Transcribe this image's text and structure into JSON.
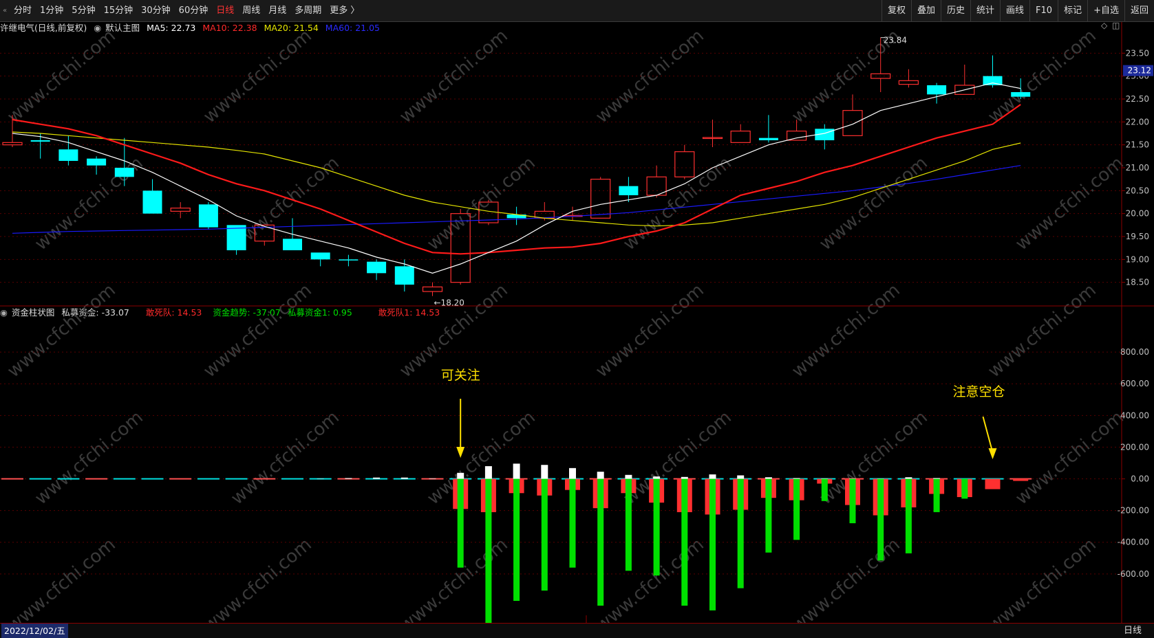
{
  "toolbar": {
    "left_items": [
      {
        "label": "分时",
        "active": false
      },
      {
        "label": "1分钟",
        "active": false
      },
      {
        "label": "5分钟",
        "active": false
      },
      {
        "label": "15分钟",
        "active": false
      },
      {
        "label": "30分钟",
        "active": false
      },
      {
        "label": "60分钟",
        "active": false
      },
      {
        "label": "日线",
        "active": true
      },
      {
        "label": "周线",
        "active": false
      },
      {
        "label": "月线",
        "active": false
      },
      {
        "label": "多周期",
        "active": false
      },
      {
        "label": "更多 〉",
        "active": false
      }
    ],
    "right_items": [
      "复权",
      "叠加",
      "历史",
      "统计",
      "画线",
      "F10",
      "标记",
      "+自选",
      "返回"
    ]
  },
  "main_indicator": {
    "stock": "许继电气(日线,前复权)",
    "template": "默认主图",
    "ma5": "MA5: 22.73",
    "ma10": "MA10: 22.38",
    "ma20": "MA20: 21.54",
    "ma60": "MA60: 21.05"
  },
  "sub_indicator": {
    "name": "资金柱状图",
    "v1": "私募资金: -33.07",
    "v2": "敢死队: 14.53",
    "v3": "资金趋势: -37.07",
    "v4": "私募资金1: 0.95",
    "v5": "敢死队1: 14.53"
  },
  "footer": {
    "date": "2022/12/02/五",
    "period": "日线"
  },
  "colors": {
    "up": "#ff3030",
    "down": "#00ffff",
    "ma5": "#ffffff",
    "ma10": "#ff1a1a",
    "ma20": "#e6e600",
    "ma60": "#1a1aff",
    "green_bar": "#00e000",
    "annotation": "#ffe000"
  },
  "chart_data": [
    {
      "type": "candlestick",
      "name": "许继电气 日线",
      "ylim": [
        18.0,
        24.0
      ],
      "yticks": [
        "18.50",
        "19.00",
        "19.50",
        "20.00",
        "20.50",
        "21.00",
        "21.50",
        "22.00",
        "22.50",
        "23.00",
        "23.50"
      ],
      "current_price": "23.12",
      "high_label": "23.84",
      "low_label": "←18.20",
      "candles": [
        {
          "o": 21.5,
          "c": 21.55,
          "h": 22.15,
          "l": 21.45
        },
        {
          "o": 21.6,
          "c": 21.57,
          "h": 21.75,
          "l": 21.2
        },
        {
          "o": 21.4,
          "c": 21.15,
          "h": 21.7,
          "l": 21.05
        },
        {
          "o": 21.2,
          "c": 21.05,
          "h": 21.25,
          "l": 20.85
        },
        {
          "o": 21.0,
          "c": 20.8,
          "h": 21.65,
          "l": 20.6
        },
        {
          "o": 20.5,
          "c": 20.0,
          "h": 20.75,
          "l": 20.0
        },
        {
          "o": 20.05,
          "c": 20.12,
          "h": 20.25,
          "l": 19.9
        },
        {
          "o": 20.2,
          "c": 19.7,
          "h": 20.25,
          "l": 19.65
        },
        {
          "o": 19.75,
          "c": 19.2,
          "h": 19.75,
          "l": 19.1
        },
        {
          "o": 19.4,
          "c": 19.75,
          "h": 19.75,
          "l": 19.3
        },
        {
          "o": 19.45,
          "c": 19.2,
          "h": 19.9,
          "l": 19.2
        },
        {
          "o": 19.15,
          "c": 19.0,
          "h": 19.15,
          "l": 18.85
        },
        {
          "o": 19.0,
          "c": 18.99,
          "h": 19.1,
          "l": 18.85
        },
        {
          "o": 18.95,
          "c": 18.7,
          "h": 19.0,
          "l": 18.55
        },
        {
          "o": 18.85,
          "c": 18.45,
          "h": 19.0,
          "l": 18.3
        },
        {
          "o": 18.3,
          "c": 18.4,
          "h": 18.5,
          "l": 18.2
        },
        {
          "o": 18.5,
          "c": 20.0,
          "h": 20.1,
          "l": 18.45
        },
        {
          "o": 19.8,
          "c": 20.25,
          "h": 20.3,
          "l": 19.75
        },
        {
          "o": 19.98,
          "c": 19.9,
          "h": 20.15,
          "l": 19.75
        },
        {
          "o": 19.9,
          "c": 20.05,
          "h": 20.25,
          "l": 19.85
        },
        {
          "o": 19.95,
          "c": 19.96,
          "h": 20.15,
          "l": 19.85
        },
        {
          "o": 19.9,
          "c": 20.75,
          "h": 20.8,
          "l": 19.9
        },
        {
          "o": 20.6,
          "c": 20.4,
          "h": 20.8,
          "l": 20.25
        },
        {
          "o": 20.4,
          "c": 20.8,
          "h": 21.05,
          "l": 20.35
        },
        {
          "o": 20.8,
          "c": 21.35,
          "h": 21.5,
          "l": 20.75
        },
        {
          "o": 21.65,
          "c": 21.66,
          "h": 22.05,
          "l": 21.45
        },
        {
          "o": 21.55,
          "c": 21.8,
          "h": 21.95,
          "l": 21.55
        },
        {
          "o": 21.65,
          "c": 21.6,
          "h": 22.15,
          "l": 21.55
        },
        {
          "o": 21.6,
          "c": 21.8,
          "h": 22.05,
          "l": 21.6
        },
        {
          "o": 21.85,
          "c": 21.6,
          "h": 21.95,
          "l": 21.4
        },
        {
          "o": 21.7,
          "c": 22.25,
          "h": 22.6,
          "l": 21.7
        },
        {
          "o": 22.95,
          "c": 23.05,
          "h": 23.84,
          "l": 22.65
        },
        {
          "o": 22.82,
          "c": 22.9,
          "h": 23.15,
          "l": 22.75
        },
        {
          "o": 22.8,
          "c": 22.6,
          "h": 22.85,
          "l": 22.4
        },
        {
          "o": 22.6,
          "c": 22.8,
          "h": 23.25,
          "l": 22.6
        },
        {
          "o": 23.0,
          "c": 22.8,
          "h": 23.45,
          "l": 22.75
        },
        {
          "o": 22.65,
          "c": 22.55,
          "h": 22.95,
          "l": 22.5
        }
      ],
      "ma5": [
        21.75,
        21.68,
        21.55,
        21.35,
        21.15,
        20.9,
        20.6,
        20.3,
        19.95,
        19.72,
        19.55,
        19.4,
        19.25,
        19.05,
        18.9,
        18.7,
        18.9,
        19.15,
        19.4,
        19.75,
        20.05,
        20.2,
        20.3,
        20.4,
        20.65,
        21.0,
        21.25,
        21.5,
        21.65,
        21.75,
        21.95,
        22.25,
        22.4,
        22.55,
        22.7,
        22.85,
        22.73
      ],
      "ma10": [
        22.05,
        21.95,
        21.85,
        21.7,
        21.5,
        21.3,
        21.1,
        20.85,
        20.65,
        20.5,
        20.3,
        20.1,
        19.85,
        19.6,
        19.35,
        19.15,
        19.12,
        19.15,
        19.2,
        19.25,
        19.27,
        19.35,
        19.5,
        19.62,
        19.8,
        20.1,
        20.4,
        20.55,
        20.7,
        20.9,
        21.05,
        21.25,
        21.45,
        21.65,
        21.8,
        21.95,
        22.38
      ],
      "ma20": [
        21.78,
        21.75,
        21.7,
        21.65,
        21.6,
        21.55,
        21.5,
        21.45,
        21.38,
        21.3,
        21.15,
        21.0,
        20.8,
        20.6,
        20.4,
        20.25,
        20.15,
        20.05,
        19.98,
        19.9,
        19.85,
        19.8,
        19.75,
        19.73,
        19.75,
        19.8,
        19.9,
        20.0,
        20.1,
        20.2,
        20.35,
        20.55,
        20.75,
        20.95,
        21.15,
        21.4,
        21.54
      ],
      "ma60": [
        19.57,
        19.59,
        19.61,
        19.62,
        19.63,
        19.64,
        19.65,
        19.66,
        19.68,
        19.7,
        19.72,
        19.74,
        19.76,
        19.78,
        19.8,
        19.82,
        19.84,
        19.86,
        19.88,
        19.91,
        19.94,
        19.98,
        20.02,
        20.08,
        20.14,
        20.2,
        20.26,
        20.32,
        20.38,
        20.44,
        20.5,
        20.58,
        20.66,
        20.75,
        20.85,
        20.95,
        21.05
      ]
    },
    {
      "type": "bar",
      "name": "资金柱状图",
      "ylim": [
        -900,
        1000
      ],
      "yticks": [
        "800.00",
        "600.00",
        "400.00",
        "200.00",
        "0.00",
        "-200.00",
        "-400.00",
        "-600.00"
      ],
      "white": [
        0,
        0,
        0,
        0,
        0,
        0,
        0,
        0,
        0,
        0,
        0,
        2,
        5,
        8,
        8,
        3,
        38,
        80,
        96,
        88,
        68,
        45,
        25,
        15,
        12,
        28,
        22,
        10,
        5,
        3,
        2,
        2,
        10,
        5,
        0,
        0,
        0
      ],
      "red": [
        0,
        0,
        0,
        0,
        0,
        0,
        0,
        0,
        0,
        0,
        0,
        0,
        0,
        0,
        0,
        0,
        -190,
        -210,
        -90,
        -105,
        -70,
        -185,
        -90,
        -150,
        -210,
        -225,
        -195,
        -120,
        -135,
        -30,
        -165,
        -230,
        -180,
        -95,
        -115,
        -65,
        -13
      ],
      "green": [
        0,
        0,
        0,
        0,
        0,
        0,
        0,
        0,
        0,
        0,
        0,
        0,
        0,
        0,
        0,
        0,
        -560,
        -910,
        -770,
        -705,
        -560,
        -800,
        -580,
        -610,
        -800,
        -830,
        -690,
        -465,
        -385,
        -140,
        -280,
        -515,
        -470,
        -210,
        -125,
        0,
        0
      ],
      "annotations": [
        {
          "text": "可关注",
          "index": 16
        },
        {
          "text": "注意空仓",
          "index": 35
        }
      ]
    }
  ]
}
